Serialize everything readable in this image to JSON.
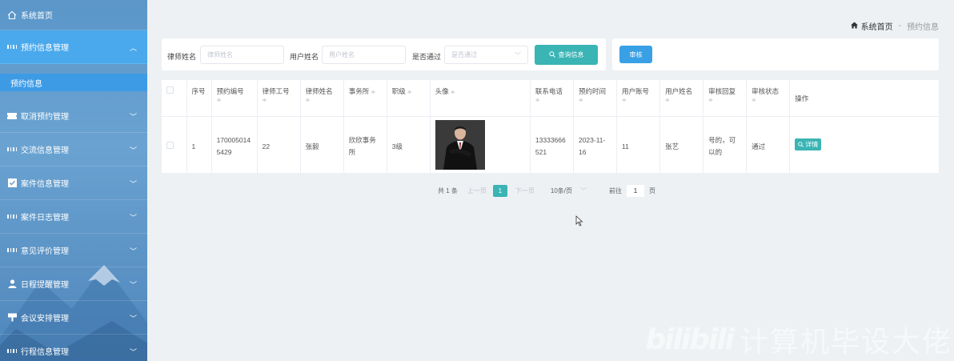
{
  "sidebar": {
    "home": "系统首页",
    "items": [
      {
        "label": "预约信息管理",
        "icon": "grid-icon",
        "expanded": true
      },
      {
        "label": "取消预约管理",
        "icon": "ticket-icon",
        "expanded": false
      },
      {
        "label": "交流信息管理",
        "icon": "grid-icon",
        "expanded": false
      },
      {
        "label": "案件信息管理",
        "icon": "check-square-icon",
        "expanded": false
      },
      {
        "label": "案件日志管理",
        "icon": "grid-icon",
        "expanded": false
      },
      {
        "label": "意见评价管理",
        "icon": "grid-icon",
        "expanded": false
      },
      {
        "label": "日程提醒管理",
        "icon": "user-icon",
        "expanded": false
      },
      {
        "label": "会议安排管理",
        "icon": "podium-icon",
        "expanded": false
      },
      {
        "label": "行程信息管理",
        "icon": "grid-icon",
        "expanded": false
      }
    ],
    "sub_item": "预约信息"
  },
  "breadcrumb": {
    "home": "系统首页",
    "separator": "-",
    "current": "预约信息"
  },
  "search": {
    "lawyer_name_label": "律师姓名",
    "lawyer_name_placeholder": "律师姓名",
    "user_name_label": "用户姓名",
    "user_name_placeholder": "用户姓名",
    "passed_label": "是否通过",
    "passed_placeholder": "是否通过",
    "query_button": "查询信息"
  },
  "actions": {
    "audit_button": "审核"
  },
  "table": {
    "headers": {
      "index": "序号",
      "booking_no": "预约编号",
      "lawyer_id": "律师工号",
      "lawyer_name": "律师姓名",
      "firm": "事务所",
      "rank": "职级",
      "avatar": "头像",
      "phone": "联系电话",
      "booking_time": "预约时间",
      "user_account": "用户账号",
      "user_name": "用户姓名",
      "audit_reply": "审核回复",
      "audit_status": "审核状态",
      "operation": "操作"
    },
    "rows": [
      {
        "index": "1",
        "booking_no": "1700050145429",
        "lawyer_id": "22",
        "lawyer_name": "张毅",
        "firm": "欣欣事务所",
        "rank": "3级",
        "phone": "13333666521",
        "booking_time": "2023-11-16",
        "user_account": "11",
        "user_name": "张艺",
        "audit_reply": "号的，可以的",
        "audit_status": "通过",
        "detail_button": "详情"
      }
    ]
  },
  "pagination": {
    "total": "共 1 条",
    "prev": "上一页",
    "current": "1",
    "next": "下一页",
    "page_size": "10条/页",
    "goto_label": "前往",
    "goto_value": "1",
    "page_suffix": "页"
  },
  "watermark": {
    "logo": "bilibili",
    "text": "计算机毕设大佬"
  },
  "colors": {
    "sidebar": "#5b96c9",
    "active": "#4aa9ec",
    "teal": "#3ab4b4",
    "blue": "#3aa0e6"
  }
}
